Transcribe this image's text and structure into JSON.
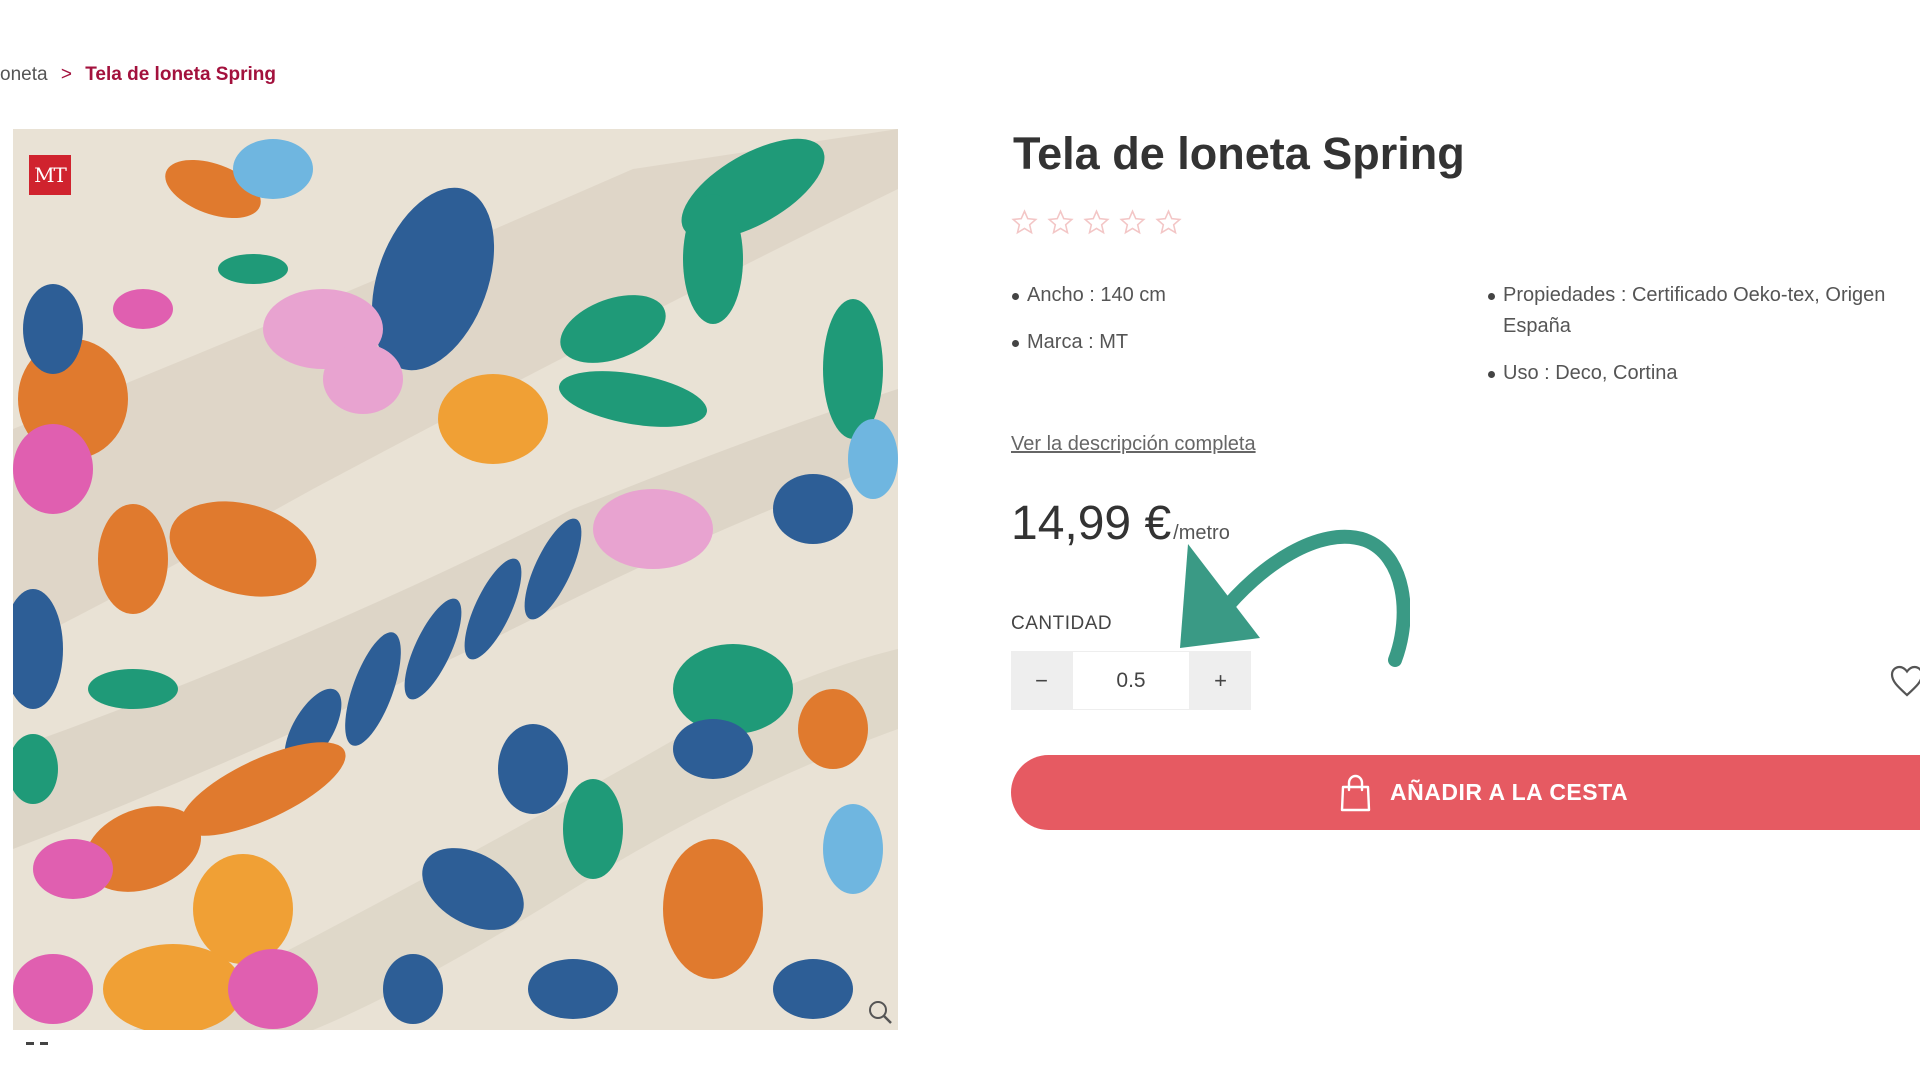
{
  "breadcrumb": {
    "previous": "oneta",
    "separator": ">",
    "current": "Tela de loneta Spring"
  },
  "product": {
    "title": "Tela de loneta Spring",
    "brand_badge": "MT",
    "rating": {
      "filled": 0,
      "max": 5
    },
    "specs_left": [
      "Ancho : 140 cm",
      "Marca : MT"
    ],
    "specs_right": [
      "Propiedades : Certificado Oeko-tex, Origen España",
      "Uso : Deco, Cortina"
    ],
    "full_description_link": "Ver la descripción completa",
    "price": {
      "amount": "14,99 €",
      "unit": "/metro"
    }
  },
  "quantity": {
    "label": "CANTIDAD",
    "decrement": "−",
    "value": "0.5",
    "increment": "+"
  },
  "cart": {
    "button_label": "AÑADIR A LA CESTA"
  },
  "colors": {
    "breadcrumb_accent": "#a3113d",
    "cart_button": "#e65a62",
    "annotation_arrow": "#3a9a85",
    "star_outline": "#f3c6c6",
    "brand_badge": "#d0232e"
  },
  "icons": {
    "cart": "shopping-bag-icon",
    "wishlist": "heart-icon",
    "zoom": "magnifier-icon",
    "rating": "star-icon",
    "annotation": "curved-arrow-icon"
  }
}
